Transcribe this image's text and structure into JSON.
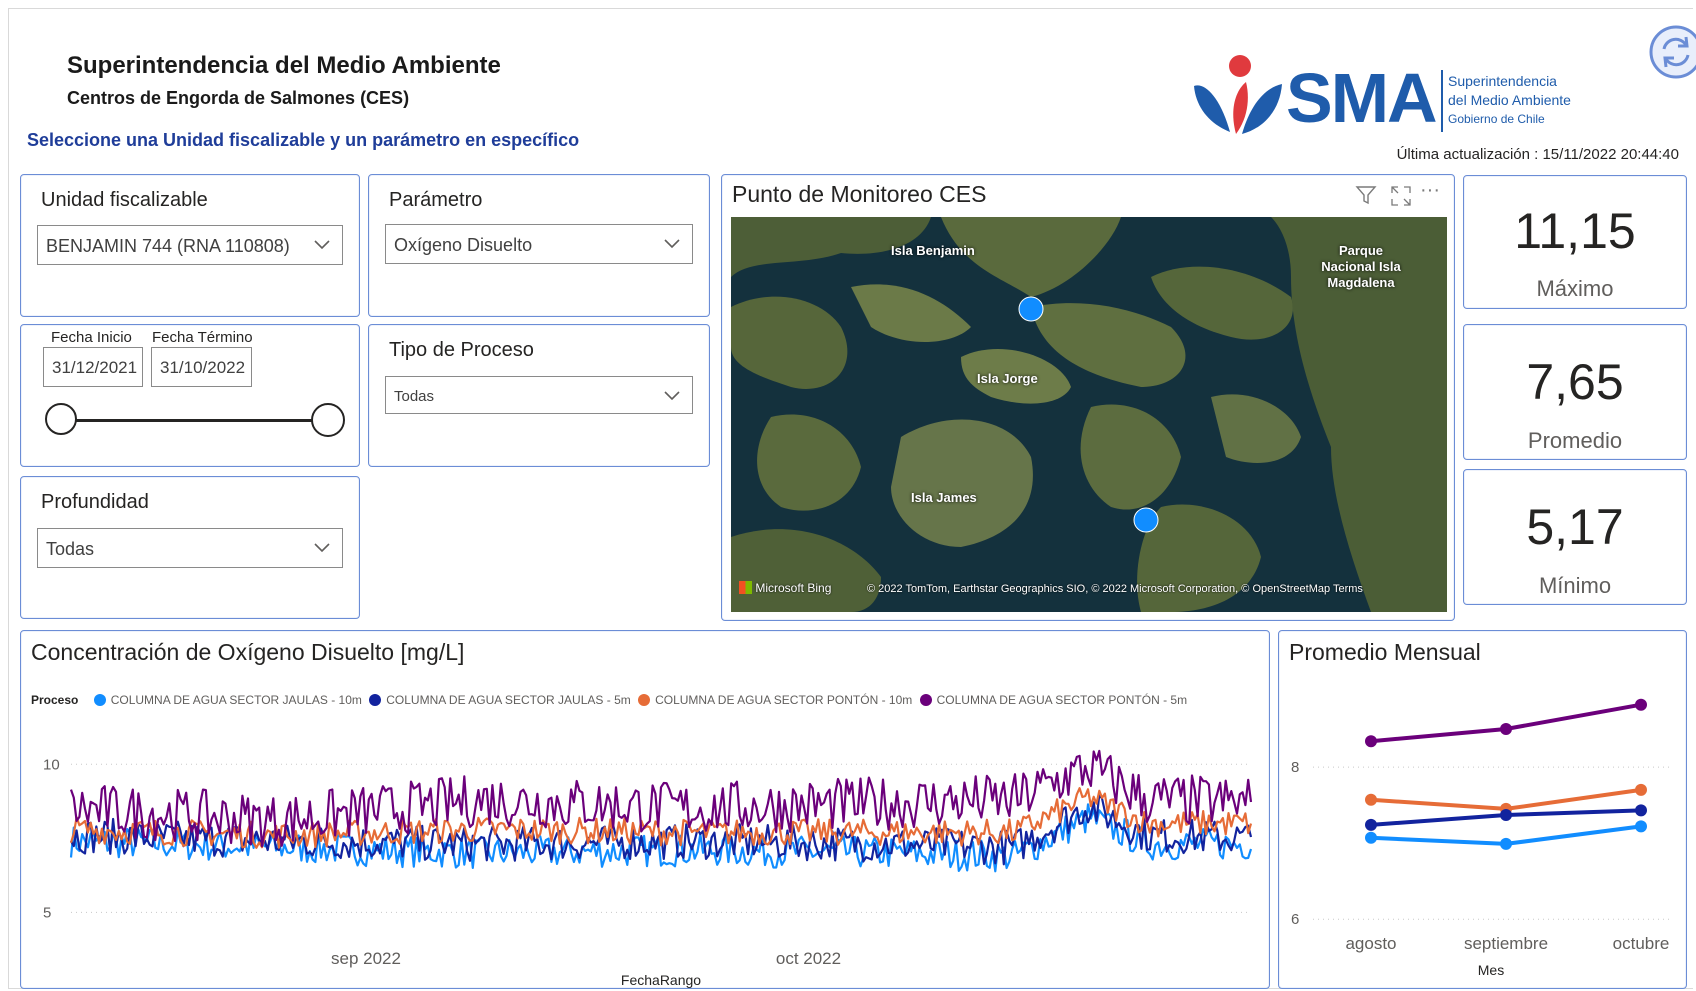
{
  "header": {
    "title": "Superintendencia del Medio Ambiente",
    "subtitle": "Centros de Engorda de Salmones (CES)",
    "instruction": "Seleccione una Unidad fiscalizable y un parámetro en específico",
    "last_update": "Última actualización : 15/11/2022 20:44:40",
    "logo": {
      "wordmark": "SMA",
      "line1": "Superintendencia",
      "line2": "del Medio Ambiente",
      "line3": "Gobierno de Chile"
    }
  },
  "slicers": {
    "unidad": {
      "title": "Unidad fiscalizable",
      "value": "BENJAMIN 744 (RNA 110808)"
    },
    "parametro": {
      "title": "Parámetro",
      "value": "Oxígeno Disuelto"
    },
    "fechas": {
      "start_label": "Fecha Inicio",
      "end_label": "Fecha Término",
      "start": "31/12/2021",
      "end": "31/10/2022"
    },
    "tipo_proceso": {
      "title": "Tipo de Proceso",
      "value": "Todas"
    },
    "profundidad": {
      "title": "Profundidad",
      "value": "Todas"
    }
  },
  "map": {
    "title": "Punto de Monitoreo CES",
    "labels": {
      "isla_benjamin": "Isla Benjamin",
      "isla_jorge": "Isla Jorge",
      "isla_james": "Isla James",
      "parque_1": "Parque",
      "parque_2": "Nacional Isla",
      "parque_3": "Magdalena"
    },
    "provider": "Microsoft Bing",
    "attribution": "© 2022 TomTom, Earthstar Geographics SIO, © 2022 Microsoft Corporation, © OpenStreetMap  Terms"
  },
  "kpis": [
    {
      "value": "11,15",
      "label": "Máximo"
    },
    {
      "value": "7,65",
      "label": "Promedio"
    },
    {
      "value": "5,17",
      "label": "Mínimo"
    }
  ],
  "colors": {
    "s1": "#118DFF",
    "s2": "#12239E",
    "s3": "#E66C37",
    "s4": "#6B007B",
    "card_border": "#6b8dd6",
    "sma_blue": "#1f5cab",
    "sma_red": "#e03a3e"
  },
  "line_chart": {
    "title": "Concentración de Oxígeno Disuelto [mg/L]",
    "legend_title": "Proceso",
    "xlabel": "FechaRango"
  },
  "monthly_chart": {
    "title": "Promedio Mensual",
    "xlabel": "Mes"
  },
  "chart_data": [
    {
      "type": "line",
      "title": "Concentración de Oxígeno Disuelto [mg/L]",
      "xlabel": "FechaRango",
      "ylabel": "",
      "x_ticks": [
        "sep 2022",
        "oct 2022"
      ],
      "x_range": [
        "2022-08-12",
        "2022-10-31"
      ],
      "y_ticks": [
        5,
        10
      ],
      "ylim": [
        4.2,
        11.8
      ],
      "grid": true,
      "legend": "top",
      "series": [
        {
          "name": "COLUMNA DE AGUA SECTOR JAULAS - 10m",
          "color": "#118DFF",
          "x": [
            "2022-08-12",
            "2022-08-26",
            "2022-09-09",
            "2022-09-23",
            "2022-10-07",
            "2022-10-15",
            "2022-10-20",
            "2022-10-24",
            "2022-10-31"
          ],
          "y": [
            7.4,
            7.2,
            7.0,
            7.1,
            7.0,
            6.9,
            8.2,
            7.3,
            7.3
          ]
        },
        {
          "name": "COLUMNA DE AGUA SECTOR JAULAS - 5m",
          "color": "#12239E",
          "x": [
            "2022-08-12",
            "2022-08-26",
            "2022-09-09",
            "2022-09-23",
            "2022-10-07",
            "2022-10-15",
            "2022-10-20",
            "2022-10-24",
            "2022-10-31"
          ],
          "y": [
            7.6,
            7.4,
            7.3,
            7.4,
            7.3,
            7.2,
            8.6,
            7.6,
            7.5
          ]
        },
        {
          "name": "COLUMNA DE AGUA SECTOR PONTÓN - 10m",
          "color": "#E66C37",
          "x": [
            "2022-08-12",
            "2022-08-26",
            "2022-09-09",
            "2022-09-23",
            "2022-10-07",
            "2022-10-15",
            "2022-10-20",
            "2022-10-24",
            "2022-10-31"
          ],
          "y": [
            7.8,
            7.6,
            7.8,
            7.7,
            7.7,
            7.7,
            8.9,
            8.0,
            8.0
          ]
        },
        {
          "name": "COLUMNA DE AGUA SECTOR PONTÓN - 5m",
          "color": "#6B007B",
          "x": [
            "2022-08-12",
            "2022-08-26",
            "2022-09-09",
            "2022-09-23",
            "2022-10-07",
            "2022-10-15",
            "2022-10-20",
            "2022-10-24",
            "2022-10-31"
          ],
          "y": [
            8.5,
            8.1,
            8.8,
            8.5,
            8.7,
            8.8,
            9.9,
            8.8,
            8.7
          ]
        }
      ]
    },
    {
      "type": "line",
      "title": "Promedio Mensual",
      "xlabel": "Mes",
      "ylabel": "",
      "categories": [
        "agosto",
        "septiembre",
        "octubre"
      ],
      "y_ticks": [
        6,
        8
      ],
      "ylim": [
        5.95,
        9.0
      ],
      "grid": true,
      "series": [
        {
          "name": "COLUMNA DE AGUA SECTOR PONTÓN - 5m",
          "color": "#6B007B",
          "values": [
            8.34,
            8.5,
            8.82
          ]
        },
        {
          "name": "COLUMNA DE AGUA SECTOR PONTÓN - 10m",
          "color": "#E66C37",
          "values": [
            7.57,
            7.45,
            7.7
          ]
        },
        {
          "name": "COLUMNA DE AGUA SECTOR JAULAS - 5m",
          "color": "#12239E",
          "values": [
            7.24,
            7.37,
            7.43
          ]
        },
        {
          "name": "COLUMNA DE AGUA SECTOR JAULAS - 10m",
          "color": "#118DFF",
          "values": [
            7.07,
            6.99,
            7.22
          ]
        }
      ]
    }
  ]
}
